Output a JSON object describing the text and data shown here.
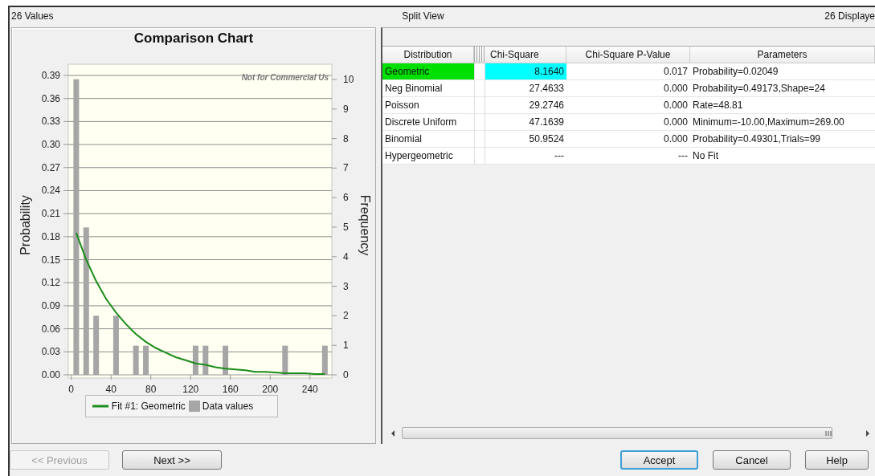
{
  "header": {
    "count": "26 Values",
    "view": "Split View",
    "displayed": "26 Displaye"
  },
  "chart": {
    "notice": "Not for Commercial Us",
    "right_axis": {
      "label": "Frequency",
      "ticks": [
        "10",
        "9",
        "8",
        "7",
        "6",
        "5",
        "4",
        "3",
        "2",
        "1",
        "0"
      ]
    },
    "chart_data": {
      "type": "bar",
      "title": "Comparison Chart",
      "ylabel": "Probability",
      "x": [
        5,
        15,
        25,
        35,
        45,
        55,
        65,
        75,
        85,
        95,
        105,
        115,
        125,
        135,
        145,
        155,
        165,
        175,
        185,
        195,
        205,
        215,
        225,
        235,
        245,
        255
      ],
      "series": [
        {
          "name": "Data values",
          "type": "bar",
          "color": "#a6a6a6",
          "values": [
            0.385,
            0.192,
            0.077,
            null,
            0.077,
            null,
            0.038,
            0.038,
            null,
            null,
            null,
            null,
            0.038,
            0.038,
            null,
            0.038,
            null,
            null,
            null,
            null,
            null,
            0.038,
            null,
            null,
            null,
            0.038
          ]
        },
        {
          "name": "Fit #1: Geometric",
          "type": "line",
          "color": "#1a8c1a",
          "values": [
            0.185,
            0.15,
            0.122,
            0.099,
            0.081,
            0.066,
            0.053,
            0.043,
            0.035,
            0.029,
            0.023,
            0.019,
            0.015,
            0.013,
            0.01,
            0.008,
            0.007,
            0.006,
            0.004,
            0.004,
            0.003,
            0.002,
            0.002,
            0.002,
            0.001,
            0.001
          ]
        }
      ],
      "grid": true,
      "xlim": [
        -3,
        262
      ],
      "ylim": [
        0,
        0.39
      ],
      "xticks": [
        0,
        40,
        80,
        120,
        160,
        200,
        240
      ],
      "yticks": [
        {
          "value": 0,
          "label": "0.00"
        },
        {
          "value": 0.03,
          "label": "0.03"
        },
        {
          "value": 0.06,
          "label": "0.06"
        },
        {
          "value": 0.09,
          "label": "0.09"
        },
        {
          "value": 0.12,
          "label": "0.12"
        },
        {
          "value": 0.15,
          "label": "0.15"
        },
        {
          "value": 0.18,
          "label": "0.18"
        },
        {
          "value": 0.21,
          "label": "0.21"
        },
        {
          "value": 0.24,
          "label": "0.24"
        },
        {
          "value": 0.27,
          "label": "0.27"
        },
        {
          "value": 0.3,
          "label": "0.30"
        },
        {
          "value": 0.33,
          "label": "0.33"
        },
        {
          "value": 0.36,
          "label": "0.36"
        },
        {
          "value": 0.39,
          "label": "0.39"
        }
      ]
    }
  },
  "table": {
    "columns": [
      "Distribution",
      "Chi-Square",
      "Chi-Square P-Value",
      "Parameters"
    ],
    "rows": [
      {
        "selected": true,
        "cells": [
          "Geometric",
          "8.1640",
          "0.017",
          "Probability=0.02049"
        ]
      },
      {
        "selected": false,
        "cells": [
          "Neg Binomial",
          "27.4633",
          "0.000",
          "Probability=0.49173,Shape=24"
        ]
      },
      {
        "selected": false,
        "cells": [
          "Poisson",
          "29.2746",
          "0.000",
          "Rate=48.81"
        ]
      },
      {
        "selected": false,
        "cells": [
          "Discrete Uniform",
          "47.1639",
          "0.000",
          "Minimum=-10.00,Maximum=269.00"
        ]
      },
      {
        "selected": false,
        "cells": [
          "Binomial",
          "50.9524",
          "0.000",
          "Probability=0.49301,Trials=99"
        ]
      },
      {
        "selected": false,
        "cells": [
          "Hypergeometric",
          "---",
          "---",
          "No Fit"
        ]
      }
    ]
  },
  "buttons": [
    {
      "label": "<< Previous",
      "disabled": true
    },
    {
      "label": "Next >>",
      "disabled": false
    },
    {
      "label": "Accept",
      "disabled": false
    },
    {
      "label": "Cancel",
      "disabled": false
    },
    {
      "label": "Help",
      "disabled": false
    }
  ]
}
